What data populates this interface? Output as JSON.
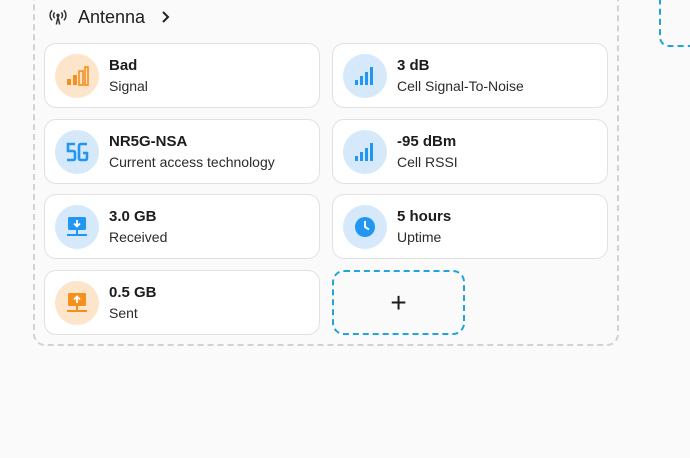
{
  "section": {
    "title": "Antenna"
  },
  "cards": [
    {
      "value": "Bad",
      "label": "Signal",
      "icon": "signal-bars-low-icon",
      "color": "#f5901e"
    },
    {
      "value": "3 dB",
      "label": "Cell Signal-To-Noise",
      "icon": "signal-bars-icon",
      "color": "#2196f3"
    },
    {
      "value": "NR5G-NSA",
      "label": "Current access technology",
      "icon": "5g-icon",
      "color": "#2196f3"
    },
    {
      "value": "-95 dBm",
      "label": "Cell RSSI",
      "icon": "signal-bars-icon",
      "color": "#2196f3"
    },
    {
      "value": "3.0 GB",
      "label": "Received",
      "icon": "download-network-icon",
      "color": "#2196f3"
    },
    {
      "value": "5 hours",
      "label": "Uptime",
      "icon": "clock-icon",
      "color": "#2196f3"
    },
    {
      "value": "0.5 GB",
      "label": "Sent",
      "icon": "upload-network-icon",
      "color": "#f5901e"
    }
  ],
  "add_card": {
    "symbol": "+"
  }
}
